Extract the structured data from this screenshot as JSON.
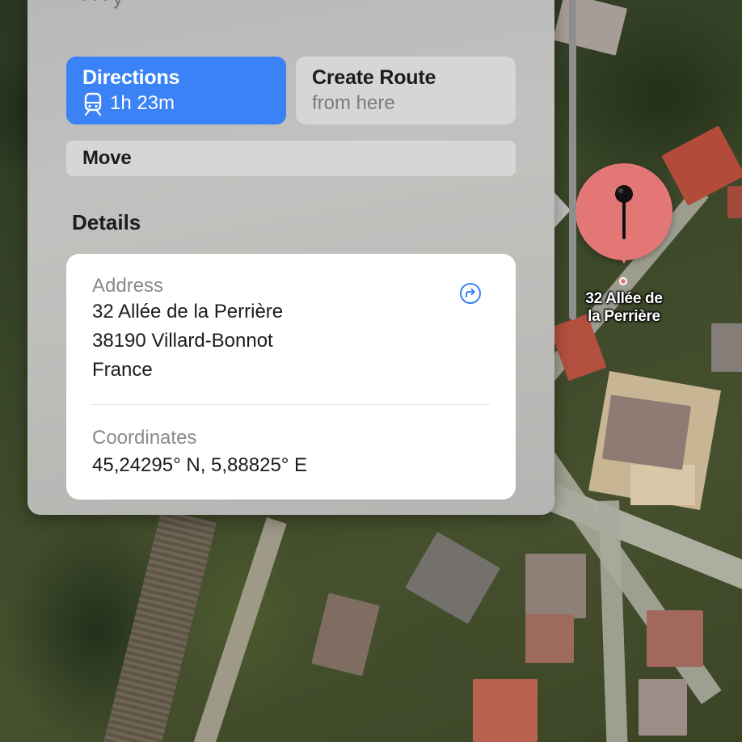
{
  "panel": {
    "peek_text": "· · · y",
    "directions": {
      "label": "Directions",
      "travel_time": "1h 23m",
      "mode_icon": "train-icon"
    },
    "create_route": {
      "label": "Create Route",
      "sublabel": "from here"
    },
    "move": {
      "label": "Move"
    },
    "details": {
      "heading": "Details",
      "address_label": "Address",
      "address_lines": [
        "32 Allée de la Perrière",
        "38190 Villard-Bonnot",
        "France"
      ],
      "coordinates_label": "Coordinates",
      "coordinates_value": "45,24295° N, 5,88825° E",
      "share_icon": "share-arrow-icon"
    }
  },
  "map": {
    "pin_label_line1": "32 Allée de",
    "pin_label_line2": "la Perrière",
    "pin_icon": "map-pin-icon",
    "pin_color": "#e37775"
  },
  "colors": {
    "accent": "#3b82f6"
  }
}
